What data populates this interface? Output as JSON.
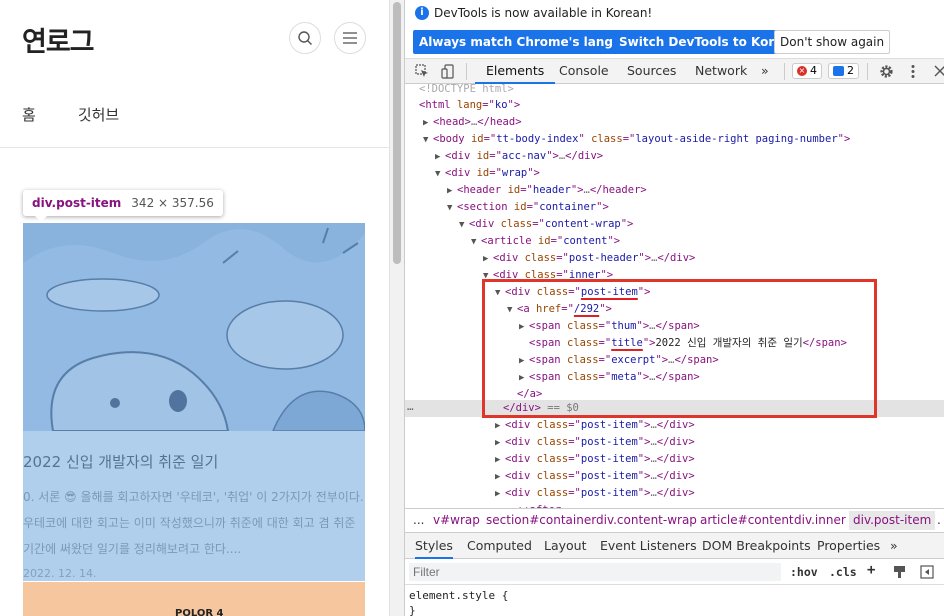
{
  "blog": {
    "logo": "연로그",
    "nav": [
      "홈",
      "깃허브"
    ],
    "tooltip": {
      "selector": "div.post-item",
      "size": "342 × 357.56"
    },
    "post": {
      "title": "2022 신입 개발자의 취준 일기",
      "excerpt": "0. 서론 😎 올해를 회고하자면 '우테코', '취업' 이 2가지가 전부이다. 우테코에 대한 회고는 이미 작성했으니까 취준에 대한 회고 겸 취준 기간에 써왔던 일기를 정리해보려고 한다....",
      "date": "2022. 12. 14."
    },
    "next_thumb_text": "POLOR 4"
  },
  "devtools": {
    "infobar": {
      "message": "DevTools is now available in Korean!",
      "btn_match": "Always match Chrome's language",
      "btn_switch": "Switch DevTools to Korean",
      "btn_dont_show": "Don't show again"
    },
    "tabs": [
      "Elements",
      "Console",
      "Sources",
      "Network"
    ],
    "more_tabs": "»",
    "error_count": "4",
    "message_count": "2",
    "breadcrumbs": [
      "...",
      "v#wrap",
      "section#container",
      "div.content-wrap",
      "article#content",
      "div.inner",
      "div.post-item",
      "."
    ],
    "styles_tabs": [
      "Styles",
      "Computed",
      "Layout",
      "Event Listeners",
      "DOM Breakpoints",
      "Properties"
    ],
    "styles_more": "»",
    "filter_placeholder": "Filter",
    "hov": ":hov",
    "cls": ".cls",
    "plus": "+",
    "element_style_open": "element.style {",
    "element_style_close": "}",
    "selected_suffix": "== $0"
  },
  "colors": {
    "accent": "#1a73e8",
    "highlight_box": "#e0352b",
    "tag": "#881280",
    "attr_name": "#994500",
    "attr_value": "#1a1aa6"
  }
}
